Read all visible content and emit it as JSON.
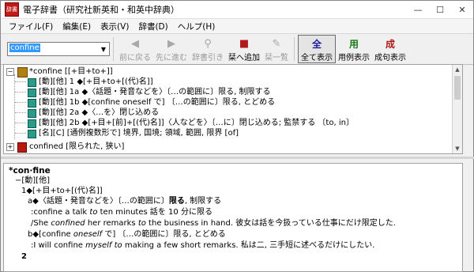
{
  "window": {
    "title": "電子辞書（研究社新英和・和英中辞典）",
    "icon_text": "辞書",
    "minimize": "—",
    "maximize": "☐",
    "close": "✕"
  },
  "menu": [
    "ファイル(F)",
    "編集(E)",
    "表示(V)",
    "辞書(D)",
    "ヘルプ(H)"
  ],
  "toolbar": {
    "search_value": "confine",
    "dropdown": "▼",
    "buttons": [
      {
        "label": "前に戻る",
        "icon": "◀",
        "disabled": true
      },
      {
        "label": "先に進む",
        "icon": "▶",
        "disabled": true
      },
      {
        "label": "辞書引き",
        "icon": "🔍",
        "disabled": true
      },
      {
        "label": "栞へ追加",
        "icon": "📕",
        "disabled": false
      },
      {
        "label": "栞一覧",
        "icon": "📑",
        "disabled": true
      }
    ],
    "view_buttons": [
      {
        "label": "全て表示",
        "icon": "全",
        "color": "#1a1a9a",
        "active": true
      },
      {
        "label": "用例表示",
        "icon": "用",
        "color": "#1a7a1a",
        "active": false
      },
      {
        "label": "成句表示",
        "icon": "成",
        "color": "#b01a1a",
        "active": false
      }
    ]
  },
  "tree": {
    "root": {
      "expander": "−",
      "text": "*confine [[+目+to+]]"
    },
    "children": [
      {
        "text": "[動][他] 1 ◆[+目+to+[(代)名]]"
      },
      {
        "text": "[動][他] 1a ◆〈話題・発音などを〉〔…の範囲に〕限る, 制限する"
      },
      {
        "text": "[動][他] 1b ◆[confine oneself で] 〔…の範囲に〕限る, とどめる"
      },
      {
        "text": "[動][他] 2a ◆〈…を〉閉じ込める"
      },
      {
        "text": "[動][他] 2b ◆[+目+[前]+[(代)名]]〈人などを〉〔…に〕閉じ込める; 監禁する 〔to, in〕"
      },
      {
        "text": "[名][C] [通例複数形で] 境界, 国境; 領域, 範囲, 限界 [of]"
      }
    ],
    "sibling": {
      "expander": "+",
      "text": "confined [限られた, 狭い]"
    }
  },
  "content": {
    "headword": "*con·fine",
    "pos": "−[動][他]",
    "sense1": "1◆[+目+to+[(代)名]]",
    "sense1a_prefix": "a◆〈話題・発音などを〉〔…の範囲に〕",
    "sense1a_bold": "限る",
    "sense1a_suffix": ", 制限する",
    "ex1_a": ":confine a talk ",
    "ex1_it": "to",
    "ex1_b": " ten minutes 話を 10 分に限る",
    "ex2_a": "/She ",
    "ex2_it": "confined",
    "ex2_b": " her remarks ",
    "ex2_it2": "to",
    "ex2_c": " the business in hand. 彼女は話を今扱っている仕事にだけ限定した.",
    "sense1b_a": "b◆[confine ",
    "sense1b_it": "oneself",
    "sense1b_b": " で] 〔…の範囲に〕限る, とどめる",
    "ex3_a": ":I will confine ",
    "ex3_it": "myself",
    "ex3_b": " ",
    "ex3_it2": "to",
    "ex3_c": " making a few short remarks. 私は二, 三手短に述べるだけにしたい.",
    "sense2": "2"
  }
}
